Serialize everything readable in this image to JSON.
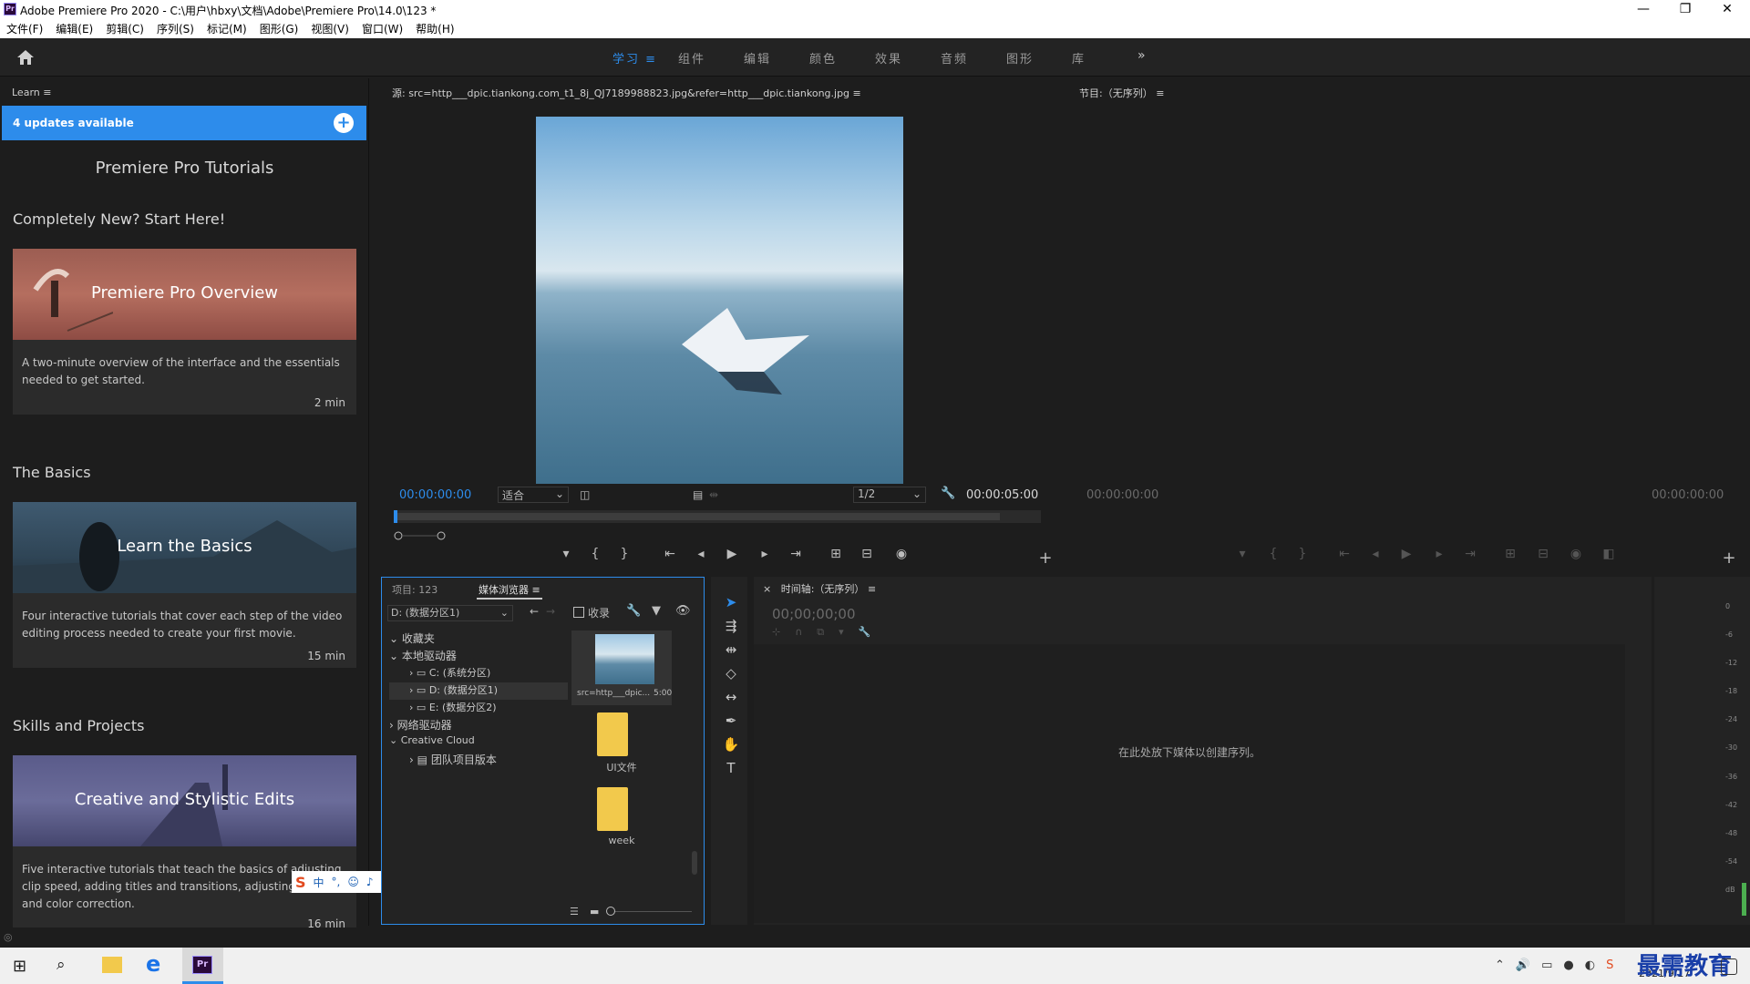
{
  "titlebar": {
    "app_icon": "Pr",
    "title": "Adobe Premiere Pro 2020 - C:\\用户\\hbxy\\文档\\Adobe\\Premiere Pro\\14.0\\123 *"
  },
  "menubar": [
    "文件(F)",
    "编辑(E)",
    "剪辑(C)",
    "序列(S)",
    "标记(M)",
    "图形(G)",
    "视图(V)",
    "窗口(W)",
    "帮助(H)"
  ],
  "workspace_tabs": [
    "学习",
    "组件",
    "编辑",
    "颜色",
    "效果",
    "音频",
    "图形",
    "库"
  ],
  "learn": {
    "title": "Learn",
    "updates": "4 updates available",
    "heading": "Premiere Pro Tutorials",
    "sections": [
      {
        "title": "Completely New? Start Here!",
        "card_title": "Premiere Pro Overview",
        "desc": "A two-minute overview of the interface and the essentials needed to get started.",
        "duration": "2 min"
      },
      {
        "title": "The Basics",
        "card_title": "Learn the Basics",
        "desc": "Four interactive tutorials that cover each step of the video editing process needed to create your first movie.",
        "duration": "15 min"
      },
      {
        "title": "Skills and Projects",
        "card_title": "Creative and Stylistic Edits",
        "desc": "Five interactive tutorials that teach the basics of adjusting clip speed, adding titles and transitions, adjusting audio, and color correction.",
        "duration": "16 min"
      }
    ]
  },
  "source": {
    "title": "源: src=http___dpic.tiankong.com_t1_8j_QJ7189988823.jpg&refer=http___dpic.tiankong.jpg",
    "timecode_in": "00:00:00:00",
    "fit": "适合",
    "resolution": "1/2",
    "timecode_out": "00:00:05:00"
  },
  "program": {
    "title": "节目:（无序列）",
    "timecode_in": "00:00:00:00",
    "timecode_out": "00:00:00:00"
  },
  "project": {
    "tab1": "项目: 123",
    "tab2": "媒体浏览器",
    "drive": "D: (数据分区1)",
    "ingest": "收录",
    "tree": [
      {
        "label": "收藏夹",
        "level": 0
      },
      {
        "label": "本地驱动器",
        "level": 0
      },
      {
        "label": "C: (系统分区)",
        "level": 1
      },
      {
        "label": "D: (数据分区1)",
        "level": 1
      },
      {
        "label": "E: (数据分区2)",
        "level": 1
      },
      {
        "label": "网络驱动器",
        "level": 0
      },
      {
        "label": "Creative Cloud",
        "level": 0
      },
      {
        "label": "团队项目版本",
        "level": 1
      }
    ],
    "thumb1_name": "src=http___dpic...",
    "thumb1_dur": "5:00",
    "folder1": "UI文件",
    "folder2": "week"
  },
  "timeline": {
    "title": "时间轴:（无序列）",
    "timecode": "00;00;00;00",
    "drop_hint": "在此处放下媒体以创建序列。"
  },
  "meters": {
    "scale": [
      "0",
      "-6",
      "-12",
      "-18",
      "-24",
      "-30",
      "-36",
      "-42",
      "-48",
      "-54",
      "dB"
    ]
  },
  "ime_bar": [
    "中",
    "°,",
    "☺",
    "🎤",
    "⌨"
  ],
  "taskbar": {
    "date": "2021/9/17",
    "watermark": "最需教育"
  },
  "colors": {
    "accent": "#2d8ceb",
    "panel_bg": "#232323",
    "app_bg": "#1d1d1d"
  }
}
